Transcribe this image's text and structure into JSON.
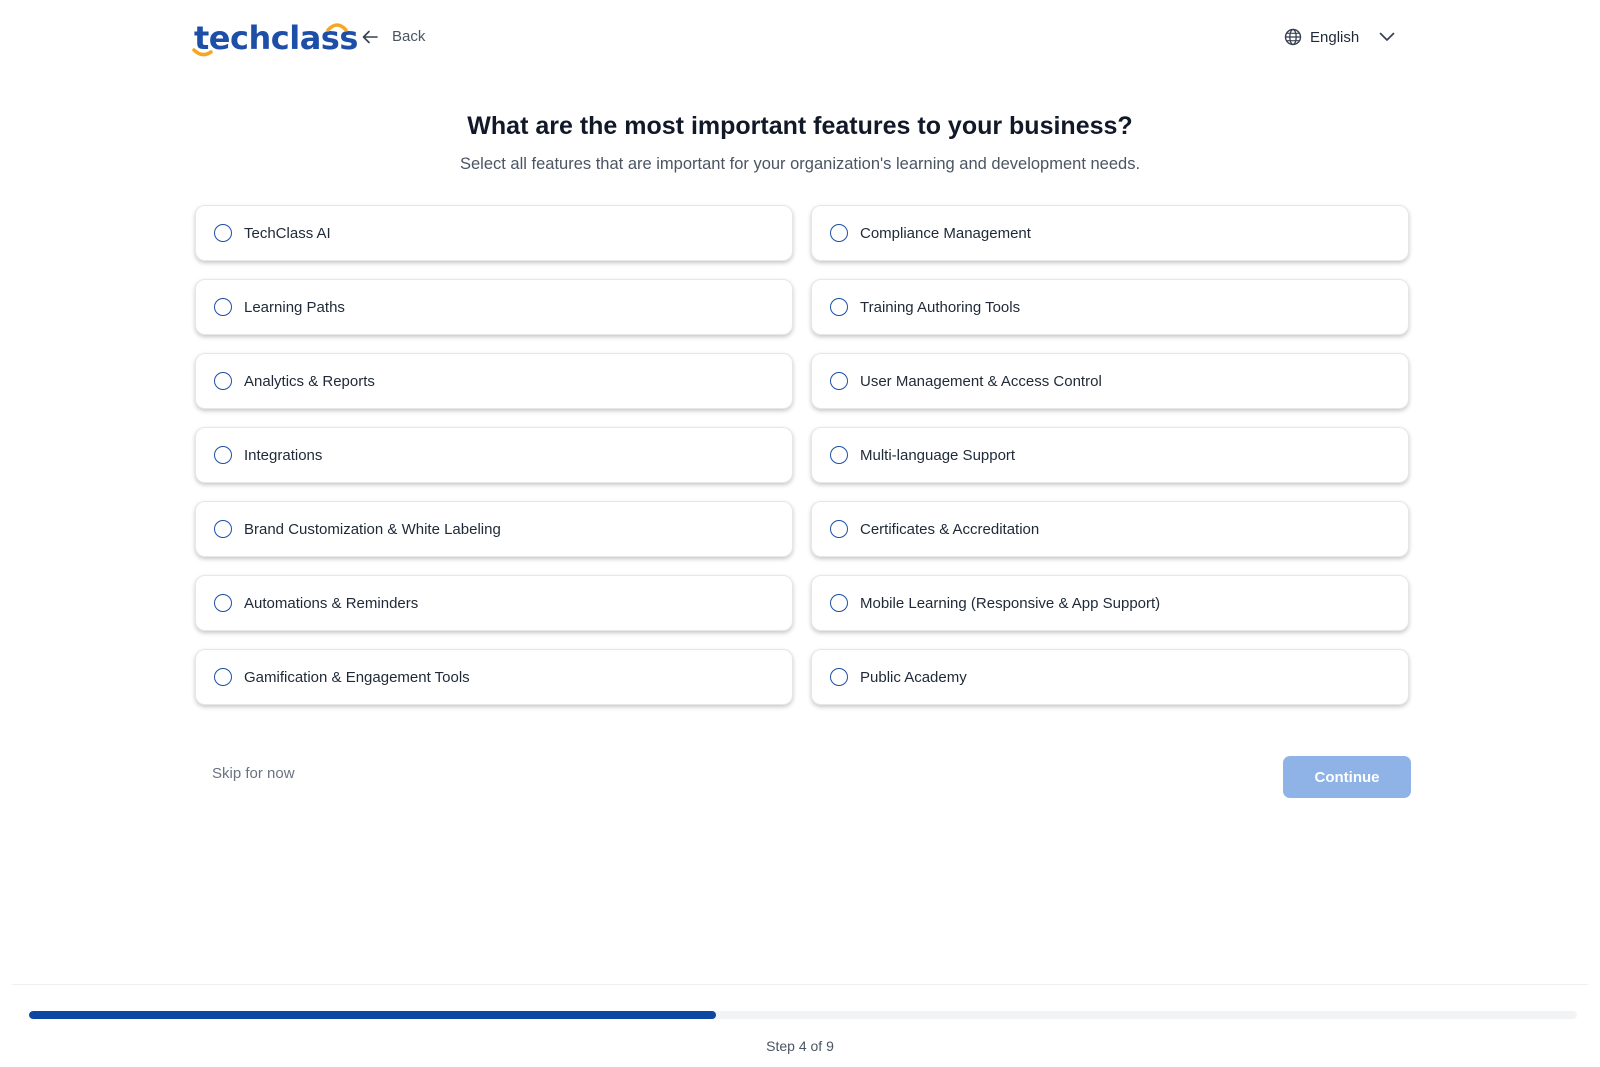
{
  "header": {
    "logo_text": "techclass",
    "back_label": "Back",
    "language": "English"
  },
  "main": {
    "title": "What are the most important features to your business?",
    "subtitle": "Select all features that are important for your organization's learning and development needs.",
    "options": [
      "TechClass AI",
      "Compliance Management",
      "Learning Paths",
      "Training Authoring Tools",
      "Analytics & Reports",
      "User Management & Access Control",
      "Integrations",
      "Multi-language Support",
      "Brand Customization & White Labeling",
      "Certificates & Accreditation",
      "Automations & Reminders",
      "Mobile Learning (Responsive & App Support)",
      "Gamification & Engagement Tools",
      "Public Academy"
    ]
  },
  "actions": {
    "skip_label": "Skip for now",
    "continue_label": "Continue"
  },
  "progress": {
    "current_step": 4,
    "total_steps": 9,
    "fraction": 0.444,
    "label": "Step 4 of 9"
  },
  "colors": {
    "brand_blue": "#1e4fa8",
    "brand_orange": "#f5a623",
    "progress_fill": "#0e47a1",
    "continue_disabled": "#8fb3e6"
  },
  "icons": {
    "back": "arrow-left-icon",
    "language": "globe-icon",
    "dropdown": "chevron-down-icon",
    "option": "radio-circle-icon"
  }
}
